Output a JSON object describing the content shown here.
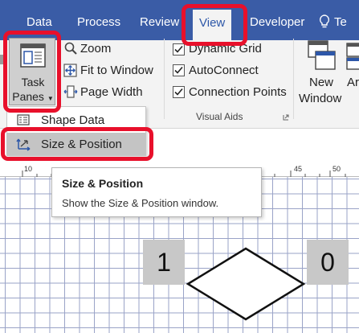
{
  "tabs": [
    {
      "label": "Data"
    },
    {
      "label": "Process"
    },
    {
      "label": "Review"
    },
    {
      "label": "View",
      "active": true
    },
    {
      "label": "Developer"
    },
    {
      "label": "Te"
    }
  ],
  "ribbon": {
    "task_panes": {
      "line1": "Task",
      "line2": "Panes"
    },
    "zoom_group": {
      "zoom": "Zoom",
      "fit_to_window": "Fit to Window",
      "page_width": "Page Width"
    },
    "visual_aids": {
      "label": "Visual Aids",
      "items": [
        {
          "label": "Dynamic Grid",
          "checked": true
        },
        {
          "label": "AutoConnect",
          "checked": true
        },
        {
          "label": "Connection Points",
          "checked": true
        }
      ]
    },
    "new_window": {
      "line1": "New",
      "line2": "Window"
    },
    "arrange_partial": "Ar"
  },
  "menu": {
    "items": [
      {
        "label": "Shape Data"
      },
      {
        "label": "Size & Position"
      }
    ]
  },
  "ruler": {
    "ticks": [
      "10",
      "45",
      "50"
    ]
  },
  "tooltip": {
    "title": "Size & Position",
    "body": "Show the Size & Position window."
  },
  "canvas": {
    "left_box_value": "1",
    "right_box_value": "0"
  },
  "colors": {
    "tabbar": "#3a5ca6",
    "active_tab_text": "#2d57a8",
    "highlight": "#e8102b"
  }
}
